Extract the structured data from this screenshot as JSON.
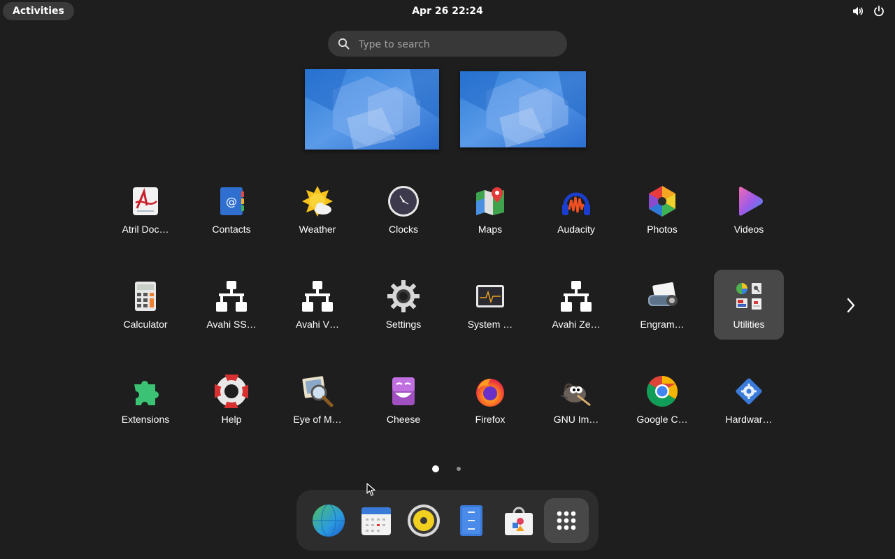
{
  "topbar": {
    "activities_label": "Activities",
    "clock": "Apr 26  22:24",
    "tray_icons": [
      "volume-icon",
      "power-icon"
    ]
  },
  "search": {
    "placeholder": "Type to search",
    "value": ""
  },
  "workspaces": [
    "workspace-1",
    "workspace-2"
  ],
  "apps": {
    "row1": [
      {
        "label": "Atril Doc…",
        "icon": "atril-icon"
      },
      {
        "label": "Contacts",
        "icon": "contacts-icon"
      },
      {
        "label": "Weather",
        "icon": "weather-icon"
      },
      {
        "label": "Clocks",
        "icon": "clocks-icon"
      },
      {
        "label": "Maps",
        "icon": "maps-icon"
      },
      {
        "label": "Audacity",
        "icon": "audacity-icon"
      },
      {
        "label": "Photos",
        "icon": "photos-icon"
      },
      {
        "label": "Videos",
        "icon": "videos-icon"
      }
    ],
    "row2": [
      {
        "label": "Calculator",
        "icon": "calculator-icon"
      },
      {
        "label": "Avahi SS…",
        "icon": "network-icon"
      },
      {
        "label": "Avahi V…",
        "icon": "network-icon"
      },
      {
        "label": "Settings",
        "icon": "gear-icon"
      },
      {
        "label": "System …",
        "icon": "system-monitor-icon"
      },
      {
        "label": "Avahi Ze…",
        "icon": "network-icon"
      },
      {
        "label": "Engram…",
        "icon": "engrampa-icon"
      },
      {
        "label": "Utilities",
        "icon": "folder-grid-icon",
        "selected": true
      }
    ],
    "row3": [
      {
        "label": "Extensions",
        "icon": "puzzle-icon"
      },
      {
        "label": "Help",
        "icon": "lifebuoy-icon"
      },
      {
        "label": "Eye of M…",
        "icon": "image-viewer-icon"
      },
      {
        "label": "Cheese",
        "icon": "cheese-icon"
      },
      {
        "label": "Firefox",
        "icon": "firefox-icon"
      },
      {
        "label": "GNU Im…",
        "icon": "gimp-icon"
      },
      {
        "label": "Google C…",
        "icon": "chrome-icon"
      },
      {
        "label": "Hardwar…",
        "icon": "hardware-icon"
      }
    ]
  },
  "pagination": {
    "pages": 2,
    "current": 1
  },
  "dock": [
    "browser-globe-icon",
    "calendar-icon",
    "speaker-icon",
    "file-manager-icon",
    "software-store-icon",
    "app-grid-icon"
  ]
}
